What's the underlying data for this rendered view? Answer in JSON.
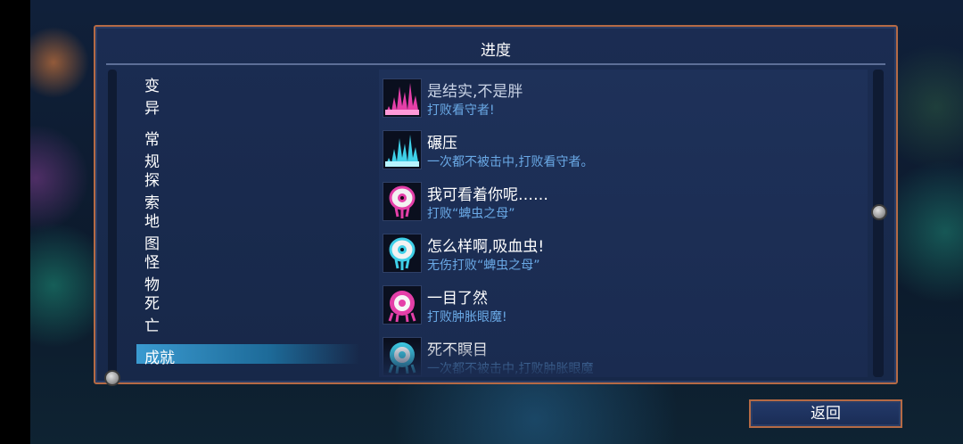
{
  "panel": {
    "title": "进度"
  },
  "categories": [
    {
      "label": "变异",
      "active": false
    },
    {
      "label": "常规",
      "active": false
    },
    {
      "label": "探索",
      "active": false
    },
    {
      "label": "地图",
      "active": false
    },
    {
      "label": "怪物",
      "active": false
    },
    {
      "label": "死亡",
      "active": false
    },
    {
      "label": "成就",
      "active": true
    }
  ],
  "achievements": [
    {
      "name": "是结实,不是胖",
      "desc": "打败看守者!",
      "icon": "pink-spikes-icon",
      "color": "#e43fa8"
    },
    {
      "name": "碾压",
      "desc": "一次都不被击中,打败看守者。",
      "icon": "cyan-spikes-icon",
      "color": "#3fd0e8"
    },
    {
      "name": "我可看着你呢……",
      "desc": "打败“蜱虫之母”",
      "icon": "pink-eye-icon",
      "color": "#e43fa8"
    },
    {
      "name": "怎么样啊,吸血虫!",
      "desc": "无伤打败“蜱虫之母”",
      "icon": "cyan-eye-icon",
      "color": "#3fd0e8"
    },
    {
      "name": "一目了然",
      "desc": "打败肿胀眼魔!",
      "icon": "pink-eyeball-icon",
      "color": "#e43fa8"
    },
    {
      "name": "死不瞑目",
      "desc": "一次都不被击中,打败肿胀眼魔",
      "icon": "cyan-eyeball-icon",
      "color": "#3fd0e8"
    }
  ],
  "back_button": {
    "label": "返回"
  }
}
